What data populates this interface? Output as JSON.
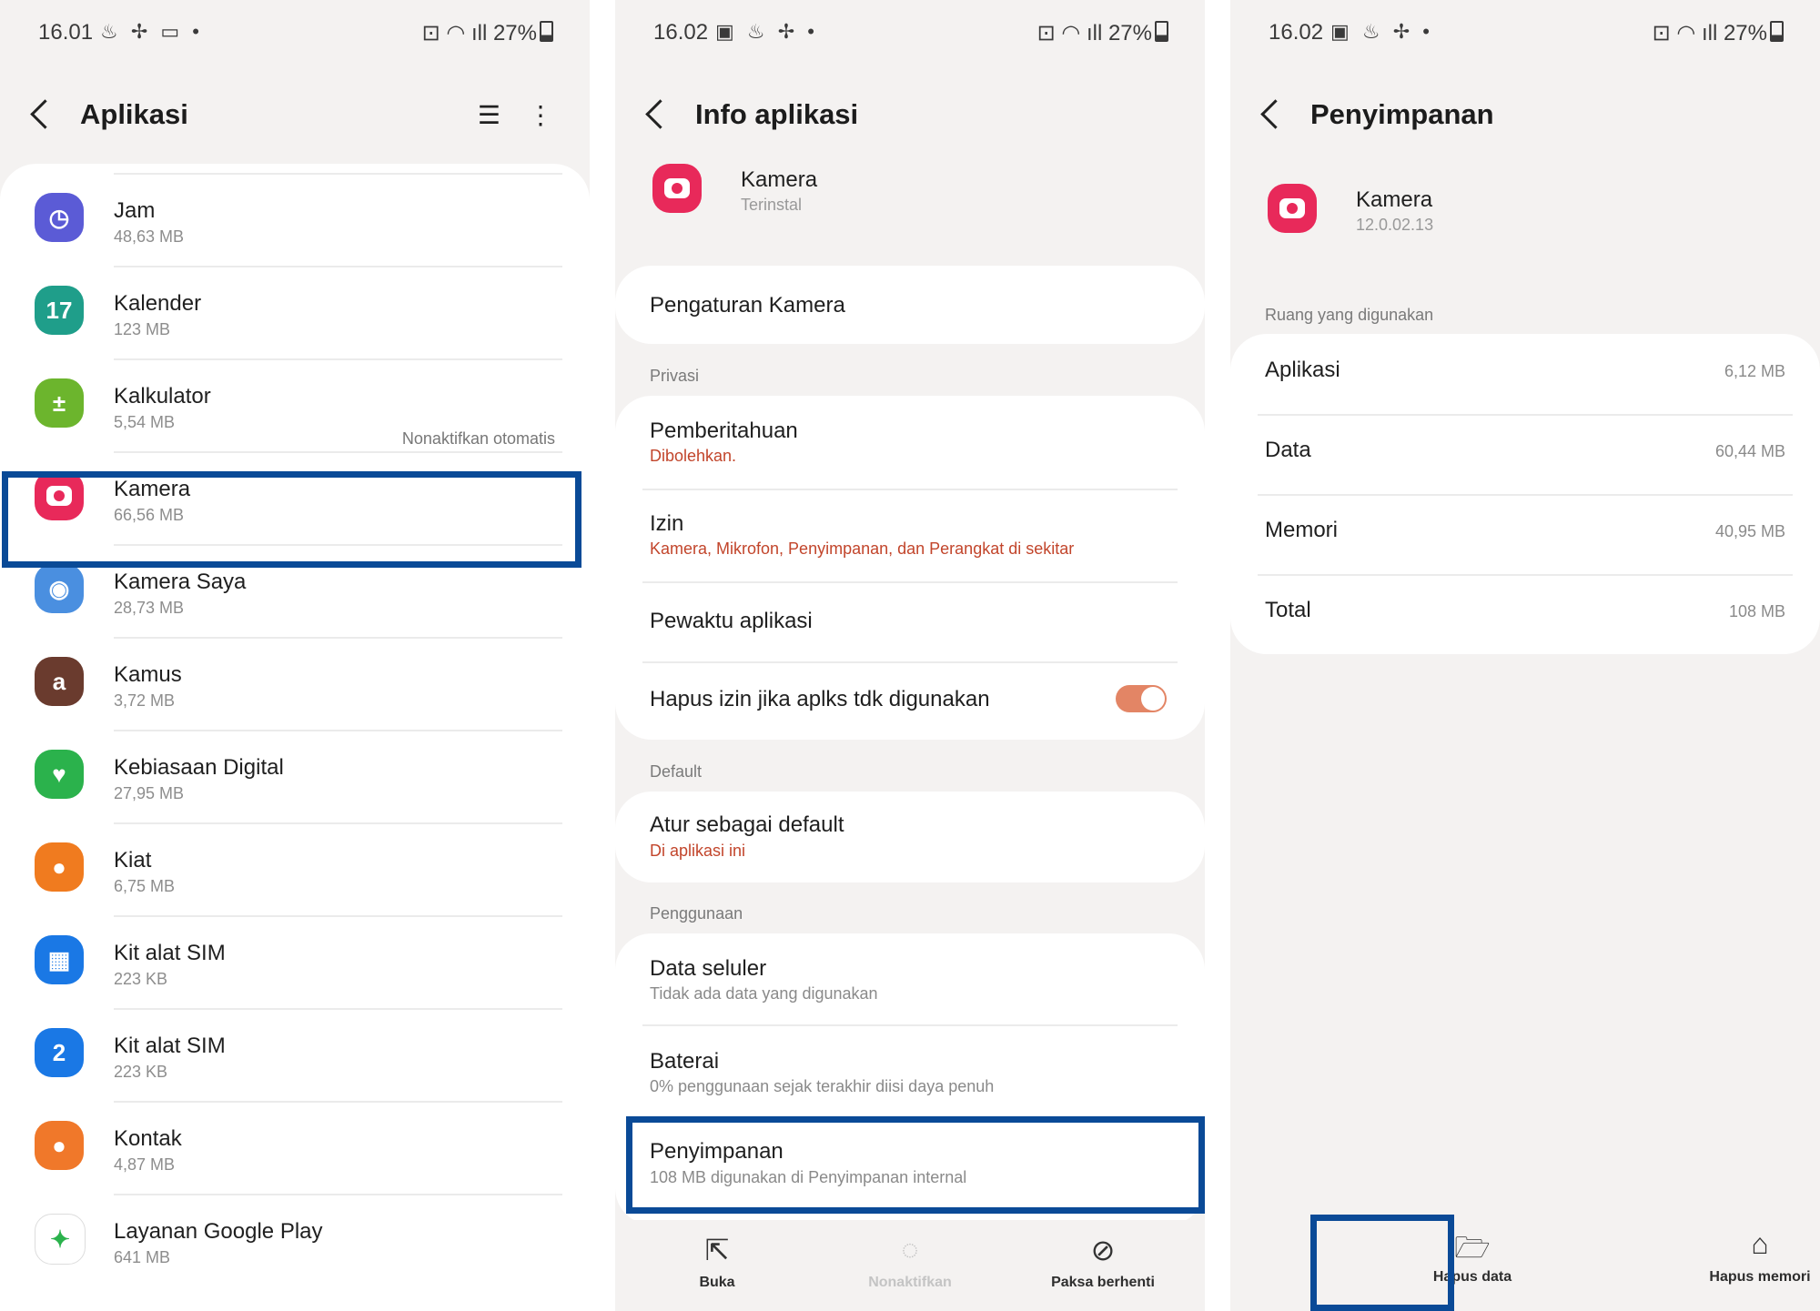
{
  "status": [
    {
      "time": "16.01",
      "left_icons": "♨ ✢ ▭ •",
      "battery": "27%"
    },
    {
      "time": "16.02",
      "left_icons": "▣ ♨ ✢ •",
      "battery": "27%"
    },
    {
      "time": "16.02",
      "left_icons": "▣ ♨ ✢ •",
      "battery": "27%"
    }
  ],
  "panel1": {
    "title": "Aplikasi",
    "apps": [
      {
        "name": "Jam",
        "size": "48,63 MB",
        "icon": "clock-icon",
        "color": "#5b5bd6",
        "glyph": "◷"
      },
      {
        "name": "Kalender",
        "size": "123 MB",
        "icon": "calendar-icon",
        "color": "#1f9e8a",
        "glyph": "17"
      },
      {
        "name": "Kalkulator",
        "size": "5,54 MB",
        "icon": "calculator-icon",
        "color": "#6cb52d",
        "glyph": "±",
        "note": "Nonaktifkan otomatis"
      },
      {
        "name": "Kamera",
        "size": "66,56 MB",
        "icon": "camera-icon",
        "color": "#e8295a",
        "glyph": ""
      },
      {
        "name": "Kamera Saya",
        "size": "28,73 MB",
        "icon": "my-camera-icon",
        "color": "#4a8fe0",
        "glyph": "◉"
      },
      {
        "name": "Kamus",
        "size": "3,72 MB",
        "icon": "dictionary-icon",
        "color": "#6a3b2e",
        "glyph": "a"
      },
      {
        "name": "Kebiasaan Digital",
        "size": "27,95 MB",
        "icon": "digital-wellbeing-icon",
        "color": "#2bb24c",
        "glyph": "♥"
      },
      {
        "name": "Kiat",
        "size": "6,75 MB",
        "icon": "tips-icon",
        "color": "#f07b1f",
        "glyph": "●"
      },
      {
        "name": "Kit alat SIM",
        "size": "223 KB",
        "icon": "sim-toolkit-icon",
        "color": "#1a78e5",
        "glyph": "▦"
      },
      {
        "name": "Kit alat SIM",
        "size": "223 KB",
        "icon": "sim-toolkit-2-icon",
        "color": "#1a78e5",
        "glyph": "2"
      },
      {
        "name": "Kontak",
        "size": "4,87 MB",
        "icon": "contacts-icon",
        "color": "#f0782a",
        "glyph": "●"
      },
      {
        "name": "Layanan Google Play",
        "size": "641 MB",
        "icon": "google-play-services-icon",
        "color": "#ffffff",
        "glyph": "✦"
      }
    ]
  },
  "panel2": {
    "title": "Info aplikasi",
    "app_name": "Kamera",
    "app_status": "Terinstal",
    "settings_label": "Pengaturan Kamera",
    "privacy_header": "Privasi",
    "notif_title": "Pemberitahuan",
    "notif_sub": "Dibolehkan.",
    "perm_title": "Izin",
    "perm_sub": "Kamera, Mikrofon, Penyimpanan, dan Perangkat di sekitar",
    "timer_title": "Pewaktu aplikasi",
    "remove_perm_title": "Hapus izin jika aplks tdk digunakan",
    "remove_perm_on": true,
    "default_header": "Default",
    "default_title": "Atur sebagai default",
    "default_sub": "Di aplikasi ini",
    "usage_header": "Penggunaan",
    "mobile_title": "Data seluler",
    "mobile_sub": "Tidak ada data yang digunakan",
    "battery_title": "Baterai",
    "battery_sub": "0% penggunaan sejak terakhir diisi daya penuh",
    "storage_title": "Penyimpanan",
    "storage_sub": "108 MB digunakan di Penyimpanan internal",
    "btn_open": "Buka",
    "btn_disable": "Nonaktifkan",
    "btn_force_stop": "Paksa berhenti"
  },
  "panel3": {
    "title": "Penyimpanan",
    "app_name": "Kamera",
    "app_version": "12.0.02.13",
    "section_header": "Ruang yang digunakan",
    "rows": [
      {
        "label": "Aplikasi",
        "value": "6,12 MB"
      },
      {
        "label": "Data",
        "value": "60,44 MB"
      },
      {
        "label": "Memori",
        "value": "40,95 MB"
      },
      {
        "label": "Total",
        "value": "108 MB"
      }
    ],
    "btn_clear_data": "Hapus data",
    "btn_clear_cache": "Hapus memori"
  },
  "colors": {
    "highlight": "#0a4a97",
    "accent_red": "#c2452b",
    "toggle": "#e38565"
  }
}
